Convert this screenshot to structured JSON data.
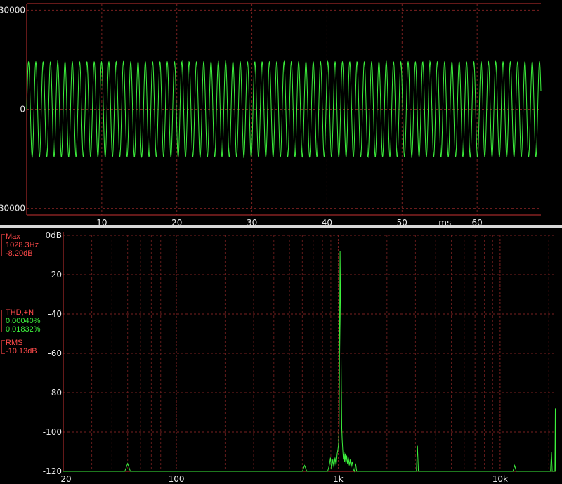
{
  "colors": {
    "background": "#000000",
    "frame": "#c83232",
    "grid": "#7a2020",
    "trace": "#3cf03c",
    "label": "#e8e8e8",
    "divider": "#d8d8d8"
  },
  "info": {
    "max_label": "Max",
    "max_freq": "1028.3Hz",
    "max_level": "-8.20dB",
    "thd_label": "THD,+N",
    "thd_value": "0.00040%",
    "thdn_value": "0.01832%",
    "rms_label": "RMS",
    "rms_value": "-10.13dB"
  },
  "chart_data": [
    {
      "type": "line",
      "xlabel": "ms",
      "ylabel": "",
      "xlim": [
        0,
        68.5
      ],
      "ylim": [
        -32000,
        32000
      ],
      "x_ticks": [
        10,
        20,
        30,
        40,
        50,
        60
      ],
      "x_tick_labels": [
        "10",
        "20",
        "30",
        "40",
        "50",
        "60"
      ],
      "y_ticks": [
        30000,
        0,
        -30000
      ],
      "y_tick_labels": [
        "30000",
        "0",
        "30000"
      ],
      "grid": true,
      "series": [
        {
          "signal": "sine",
          "frequency_hz": 1028.3,
          "amplitude": 14500,
          "offset": 0
        }
      ]
    },
    {
      "type": "line",
      "xscale": "log",
      "xlim": [
        20,
        22050
      ],
      "ylim": [
        -120,
        0
      ],
      "x_ticks": [
        20,
        100,
        1000,
        10000
      ],
      "x_tick_labels": [
        "20",
        "100",
        "1k",
        "10k"
      ],
      "y_ticks": [
        0,
        -20,
        -40,
        -60,
        -80,
        -100,
        -120
      ],
      "y_tick_labels": [
        "0dB",
        "-20",
        "-40",
        "-60",
        "-80",
        "-100",
        "-120"
      ],
      "grid": true,
      "series": [
        {
          "points": [
            [
              20,
              -120
            ],
            [
              48,
              -120
            ],
            [
              50,
              -116
            ],
            [
              52,
              -120
            ],
            [
              600,
              -120
            ],
            [
              620,
              -117
            ],
            [
              640,
              -120
            ],
            [
              860,
              -120
            ],
            [
              880,
              -117
            ],
            [
              895,
              -113
            ],
            [
              910,
              -119
            ],
            [
              925,
              -114
            ],
            [
              940,
              -118
            ],
            [
              955,
              -113
            ],
            [
              970,
              -117
            ],
            [
              985,
              -111
            ],
            [
              995,
              -109
            ],
            [
              1005,
              -106
            ],
            [
              1012,
              -96
            ],
            [
              1018,
              -70
            ],
            [
              1022,
              -40
            ],
            [
              1025,
              -20
            ],
            [
              1027,
              -8.2
            ],
            [
              1030,
              -20
            ],
            [
              1035,
              -44
            ],
            [
              1040,
              -58
            ],
            [
              1046,
              -80
            ],
            [
              1052,
              -98
            ],
            [
              1058,
              -104
            ],
            [
              1066,
              -109
            ],
            [
              1076,
              -114
            ],
            [
              1086,
              -110
            ],
            [
              1096,
              -115
            ],
            [
              1106,
              -111
            ],
            [
              1116,
              -116
            ],
            [
              1128,
              -112
            ],
            [
              1140,
              -116
            ],
            [
              1155,
              -113
            ],
            [
              1170,
              -117
            ],
            [
              1185,
              -114
            ],
            [
              1200,
              -118
            ],
            [
              1218,
              -115
            ],
            [
              1240,
              -119
            ],
            [
              1260,
              -120
            ],
            [
              1280,
              -116
            ],
            [
              1300,
              -120
            ],
            [
              3040,
              -120
            ],
            [
              3085,
              -107
            ],
            [
              3130,
              -120
            ],
            [
              12000,
              -120
            ],
            [
              12300,
              -117
            ],
            [
              12600,
              -120
            ],
            [
              20500,
              -120
            ],
            [
              20750,
              -110
            ],
            [
              21000,
              -120
            ],
            [
              21800,
              -120
            ],
            [
              21950,
              -88
            ],
            [
              22050,
              -120
            ]
          ]
        }
      ]
    }
  ]
}
